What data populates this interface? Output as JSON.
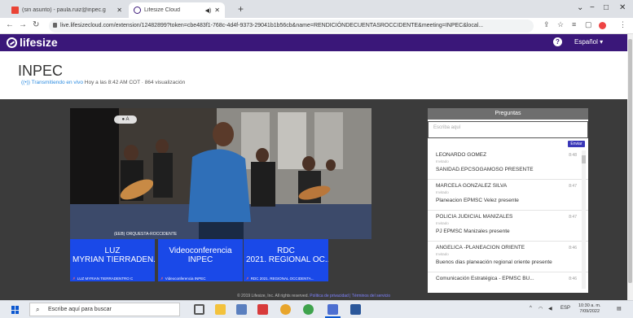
{
  "browser": {
    "tabs": [
      {
        "title": "(sin asunto) - paula.ruiz@inpec.g",
        "close": "✕"
      },
      {
        "title": "Lifesize Cloud",
        "close": "✕"
      }
    ],
    "new_tab": "+",
    "window_controls": {
      "minimize": "−",
      "maximize": "□",
      "close": "✕"
    },
    "url": "live.lifesizecloud.com/extension/12482899?token=cbe483f1-768c-4d4f-9373-29041b1b56cb&name=RENDICIÓNDECUENTASROCCIDENTE&meeting=INPEC&local..."
  },
  "header": {
    "logo": "lifesize",
    "help": "?",
    "language": "Español ▾"
  },
  "event": {
    "title": "INPEC",
    "live_status": "((•)) Transmitiendo en vivo",
    "meta": "Hoy a las 8:42 AM COT · 864 visualización"
  },
  "video": {
    "badge": "● A",
    "caption": "(EEB) ORQUESTA-ROCCIDENTE"
  },
  "participants": [
    {
      "line1": "LUZ",
      "line2": "MYRIAN TIERRADEN...",
      "caption": "LUZ MYRIAN TIERRADENTRO C"
    },
    {
      "line1": "Videoconferencia",
      "line2": "INPEC",
      "caption": "Videoconferencia INPEC"
    },
    {
      "line1": "RDC",
      "line2": "2021. REGIONAL OC...",
      "caption": "RDC 2021. REGIONAL OCCIDENTA..."
    }
  ],
  "questions": {
    "title": "Preguntas",
    "input_placeholder": "Escriba aquí",
    "send_label": "Enviar",
    "items": [
      {
        "name": "LEONARDO GOMEZ",
        "role": "Invitado",
        "time": "8:48",
        "message": "SANIDAD.EPCSOGAMOSO PRESENTE"
      },
      {
        "name": "MARCELA GONZALEZ SILVA",
        "role": "Invitado",
        "time": "8:47",
        "message": "Planeacion EPMSC Velez presente"
      },
      {
        "name": "POLICIA JUDICIAL MANIZALES",
        "role": "Invitado",
        "time": "8:47",
        "message": "PJ EPMSC Manizales presente"
      },
      {
        "name": "ANGELICA -PLANEACION ORIENTE",
        "role": "Invitado",
        "time": "8:46",
        "message": "Buenos dias planeación regional oriente presente"
      },
      {
        "name": "Comunicación Estratégica - EPMSC BU...",
        "role": "Invitado",
        "time": "8:46",
        "message": ""
      }
    ]
  },
  "footer": {
    "copyright": "© 2019 Lifesize, Inc. All rights reserved.",
    "links": "Política de privacidad | Términos del servicio"
  },
  "taskbar": {
    "search_placeholder": "Escribe aquí para buscar",
    "tray_lang": "ESP",
    "time": "10:30 a. m.",
    "date": "7/09/2022"
  },
  "colors": {
    "brand_purple": "#3a1779",
    "tile_blue": "#1a49e8",
    "stage_bg": "#3b3b3b"
  }
}
